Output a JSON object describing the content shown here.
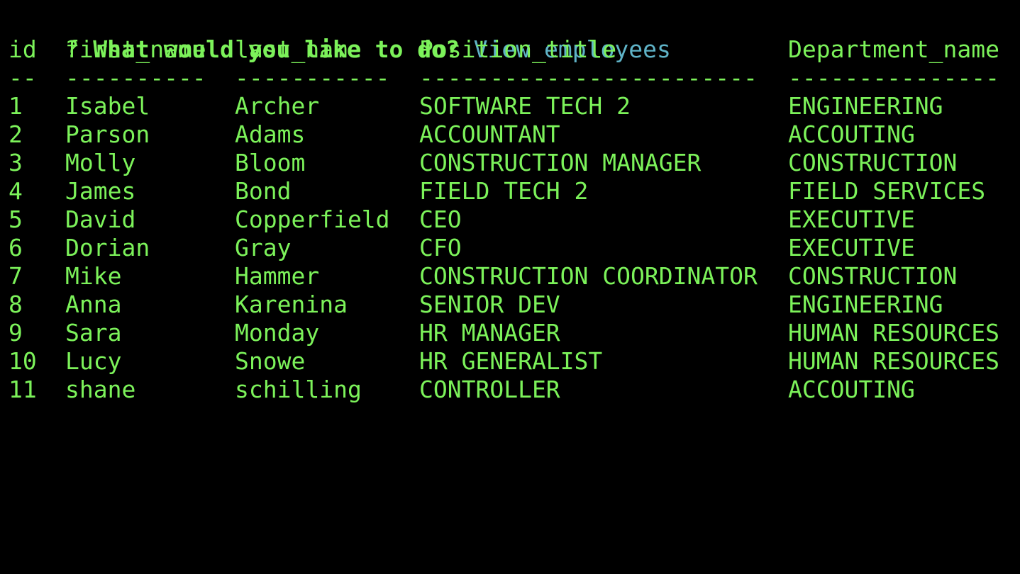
{
  "prompt": {
    "mark": "?",
    "question": "What would you like to do?",
    "answer": "View employees"
  },
  "table": {
    "columns": [
      "id",
      "first_name",
      "last_name",
      "Position_title",
      "Department_name"
    ],
    "separators": [
      "--",
      "----------",
      "-----------",
      "------------------------",
      "---------------"
    ],
    "rows": [
      [
        "1",
        "Isabel",
        "Archer",
        "SOFTWARE TECH 2",
        "ENGINEERING"
      ],
      [
        "2",
        "Parson",
        "Adams",
        "ACCOUNTANT",
        "ACCOUTING"
      ],
      [
        "3",
        "Molly",
        "Bloom",
        "CONSTRUCTION MANAGER",
        "CONSTRUCTION"
      ],
      [
        "4",
        "James",
        "Bond",
        "FIELD TECH 2",
        "FIELD SERVICES"
      ],
      [
        "5",
        "David",
        "Copperfield",
        "CEO",
        "EXECUTIVE"
      ],
      [
        "6",
        "Dorian",
        "Gray",
        "CFO",
        "EXECUTIVE"
      ],
      [
        "7",
        "Mike",
        "Hammer",
        "CONSTRUCTION COORDINATOR",
        "CONSTRUCTION"
      ],
      [
        "8",
        "Anna",
        "Karenina",
        "SENIOR DEV",
        "ENGINEERING"
      ],
      [
        "9",
        "Sara",
        "Monday",
        "HR MANAGER",
        "HUMAN RESOURCES"
      ],
      [
        "10",
        "Lucy",
        "Snowe",
        "HR GENERALIST",
        "HUMAN RESOURCES"
      ],
      [
        "11",
        "shane",
        "schilling",
        "CONTROLLER",
        "ACCOUTING"
      ]
    ]
  },
  "colors": {
    "background": "#000000",
    "text": "#7cf25a",
    "answer": "#5fb3c7"
  }
}
